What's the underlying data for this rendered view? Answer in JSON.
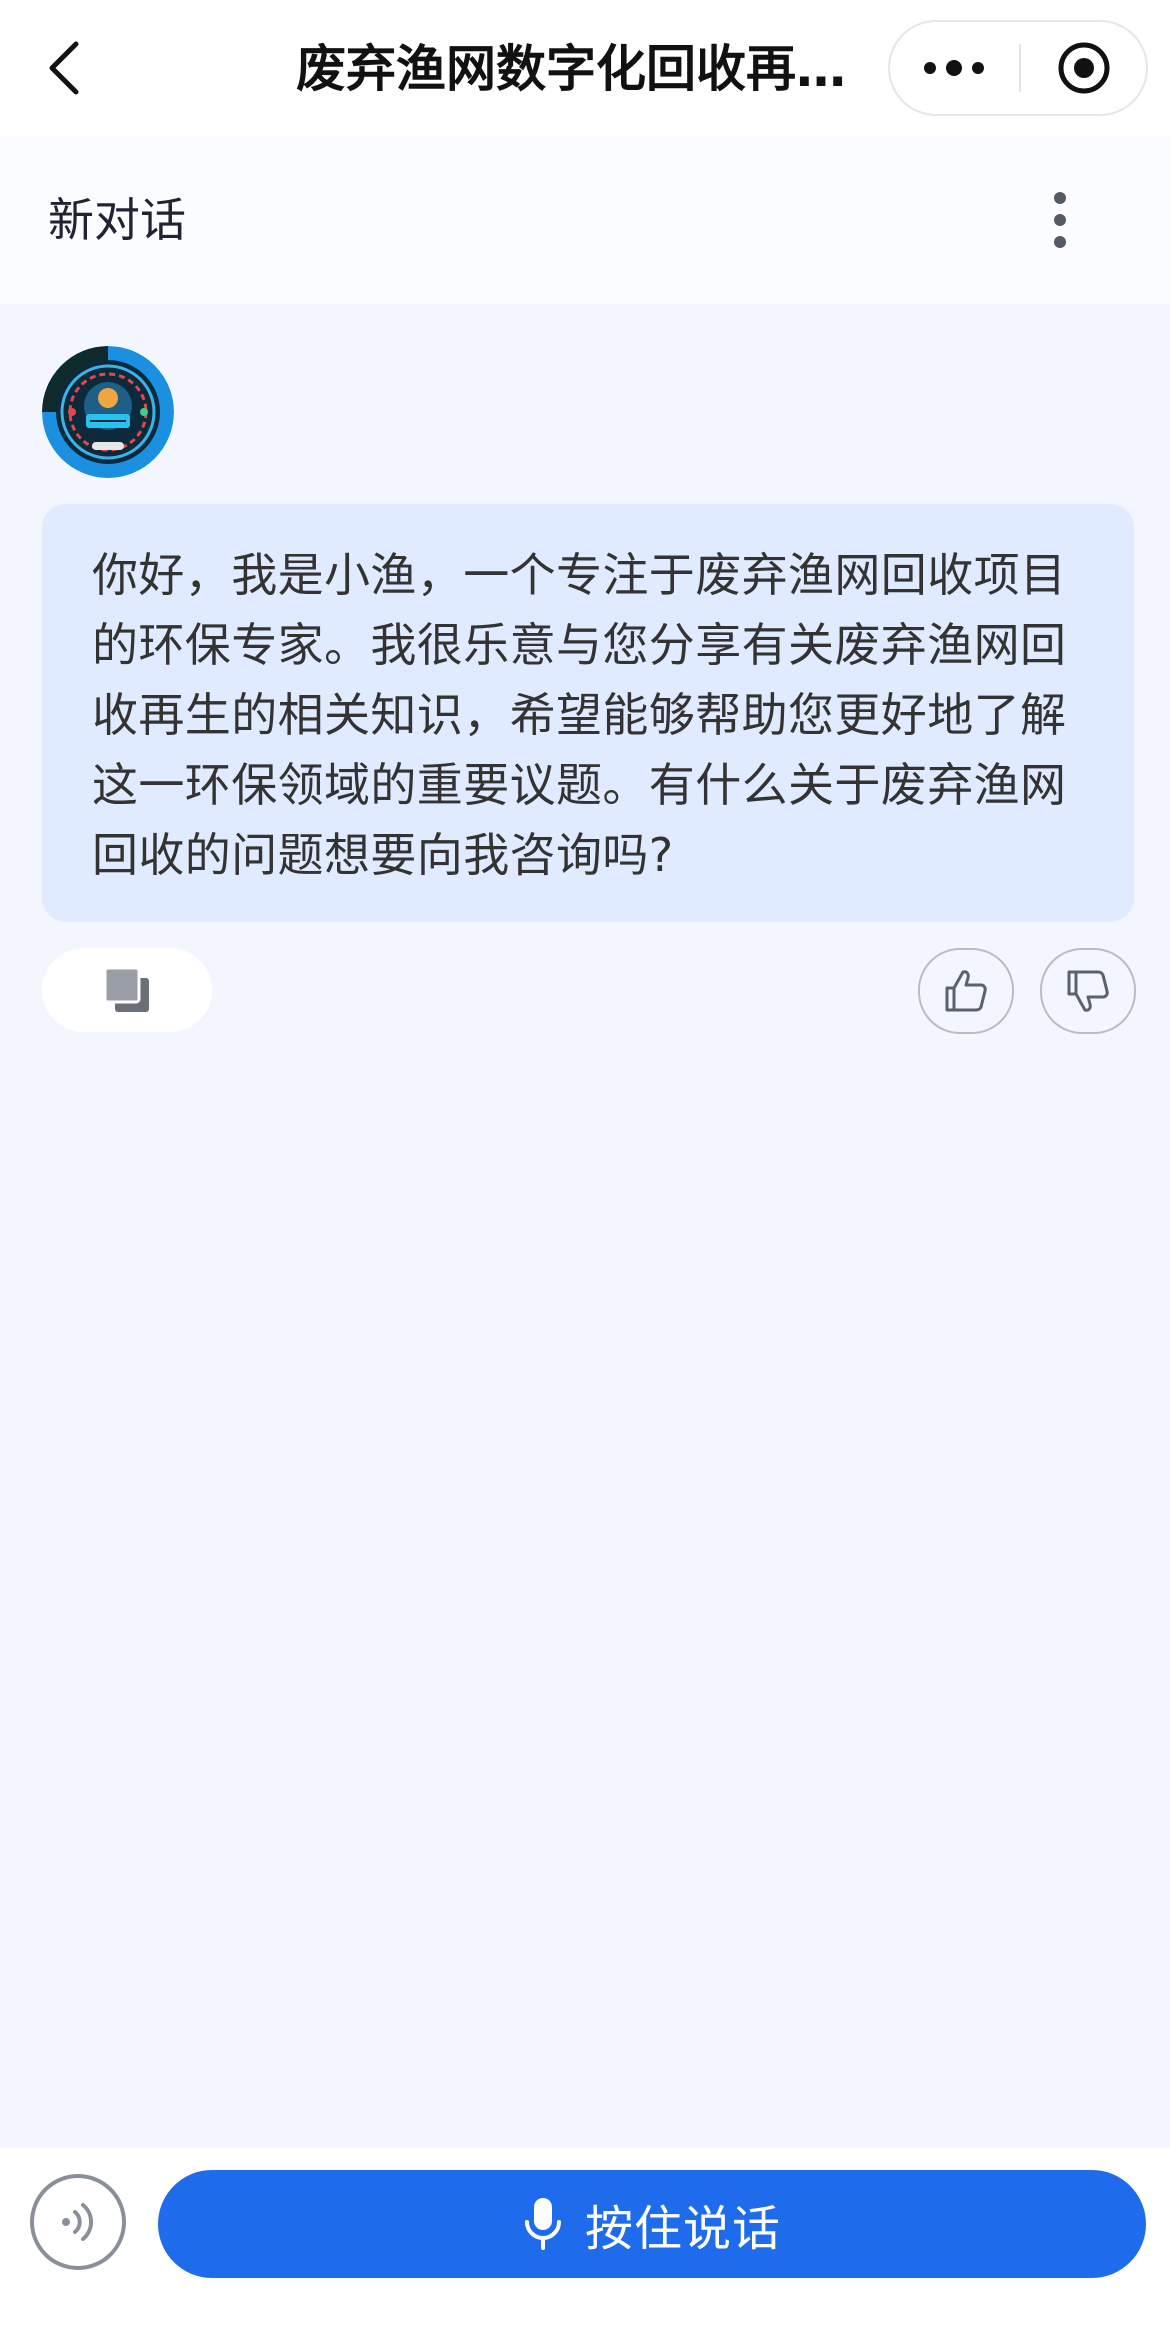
{
  "nav": {
    "title": "废弃渔网数字化回收再…",
    "back_icon": "chevron-left-icon",
    "more_icon": "more-dots-icon",
    "close_icon": "target-close-icon"
  },
  "conversation": {
    "title": "新对话",
    "menu_icon": "kebab-icon"
  },
  "messages": [
    {
      "role": "assistant",
      "avatar": "fishing-net-badge-avatar",
      "text": "你好，我是小渔，一个专注于废弃渔网回收项目的环保专家。我很乐意与您分享有关废弃渔网回收再生的相关知识，希望能够帮助您更好地了解这一环保领域的重要议题。有什么关于废弃渔网回收的问题想要向我咨询吗?",
      "actions": {
        "copy_icon": "copy-icon",
        "like_icon": "thumbs-up-icon",
        "dislike_icon": "thumbs-down-icon"
      }
    }
  ],
  "input": {
    "voice_toggle_icon": "voice-wave-icon",
    "talk_label": "按住说话",
    "mic_icon": "microphone-icon"
  },
  "colors": {
    "accent": "#1e6ceb",
    "bubble": "#e0ebff",
    "page_background": "#f3f6fe"
  }
}
